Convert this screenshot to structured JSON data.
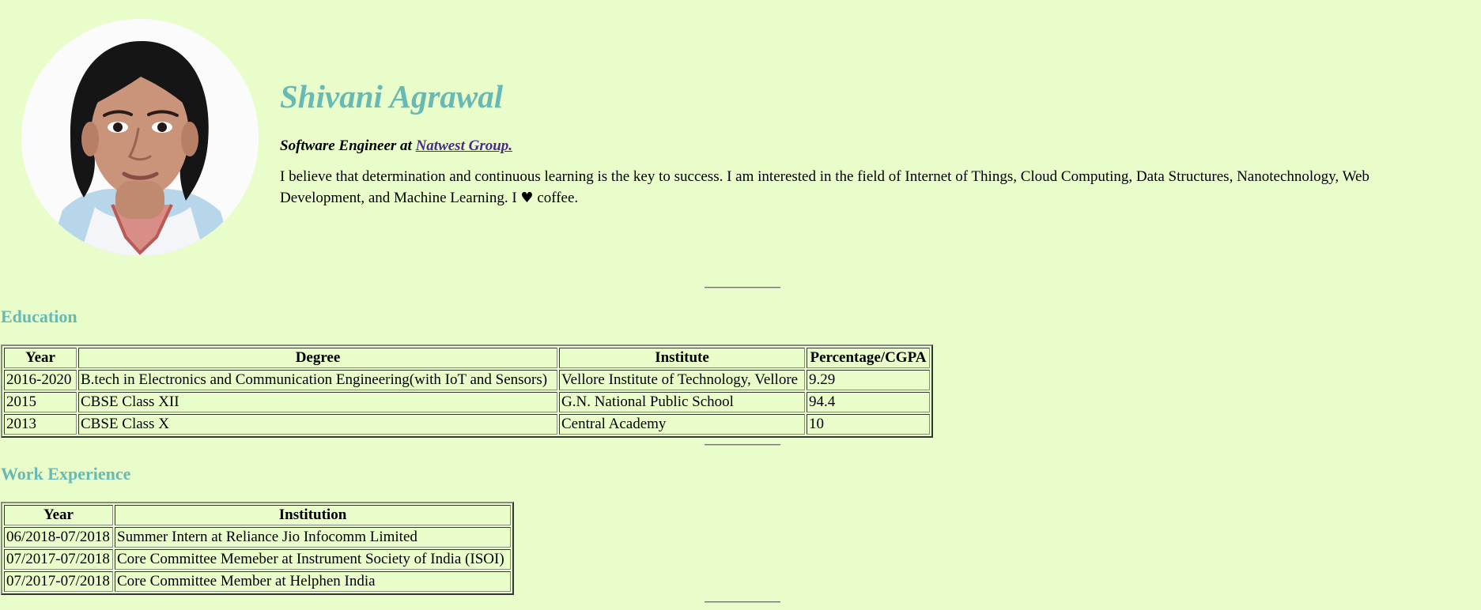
{
  "profile": {
    "name": "Shivani Agrawal",
    "role_prefix": "Software Engineer at",
    "company": "Natwest Group.",
    "bio_text": "I believe that determination and continuous learning is the key to success. I am interested in the field of Internet of Things, Cloud Computing, Data Structures, Nanotechnology, Web Development, and Machine Learning. I",
    "bio_icon": "heart-icon",
    "bio_suffix": "coffee."
  },
  "education": {
    "heading": "Education",
    "columns": [
      "Year",
      "Degree",
      "Institute",
      "Percentage/CGPA"
    ],
    "rows": [
      [
        "2016-2020",
        "B.tech in Electronics and Communication Engineering(with IoT and Sensors)",
        "Vellore Institute of Technology, Vellore",
        "9.29"
      ],
      [
        "2015",
        "CBSE Class XII",
        "G.N. National Public School",
        "94.4"
      ],
      [
        "2013",
        "CBSE Class X",
        "Central Academy",
        "10"
      ]
    ]
  },
  "work": {
    "heading": "Work Experience",
    "columns": [
      "Year",
      "Institution"
    ],
    "rows": [
      [
        "06/2018-07/2018",
        "Summer Intern at Reliance Jio Infocomm Limited"
      ],
      [
        "07/2017-07/2018",
        "Core Committee Memeber at Instrument Society of India (ISOI)"
      ],
      [
        "07/2017-07/2018",
        "Core Committee Member at Helphen India"
      ]
    ]
  },
  "colors": {
    "background": "#e9fdca",
    "heading": "#66b9b5",
    "link": "#4b2a8b"
  }
}
